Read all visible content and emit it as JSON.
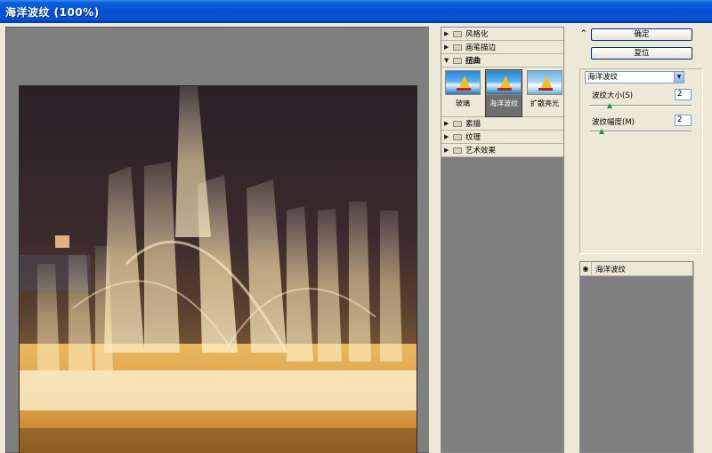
{
  "window": {
    "title": "海洋波纹 (100%)"
  },
  "gallery": {
    "categories_top": [
      {
        "label": "风格化",
        "open": false
      },
      {
        "label": "画笔描边",
        "open": false
      },
      {
        "label": "扭曲",
        "open": true
      }
    ],
    "thumbnails": [
      {
        "label": "玻璃",
        "selected": false
      },
      {
        "label": "海洋波纹",
        "selected": true
      },
      {
        "label": "扩散亮光",
        "selected": false
      }
    ],
    "categories_bottom": [
      {
        "label": "素描",
        "open": false
      },
      {
        "label": "纹理",
        "open": false
      },
      {
        "label": "艺术效果",
        "open": false
      }
    ]
  },
  "buttons": {
    "ok": "确定",
    "reset": "复位"
  },
  "settings": {
    "filter_select": "海洋波纹",
    "params": [
      {
        "label": "波纹大小(S)",
        "value": "2",
        "fraction": 0.133
      },
      {
        "label": "波纹幅度(M)",
        "value": "2",
        "fraction": 0.1
      }
    ]
  },
  "layers": {
    "items": [
      {
        "label": "海洋波纹"
      }
    ]
  },
  "icons": {
    "collapse": "double-chevron-up-icon",
    "expand": "triangle-right-icon",
    "folder": "folder-icon",
    "eye": "eye-icon",
    "dropdown": "chevron-down-icon"
  }
}
